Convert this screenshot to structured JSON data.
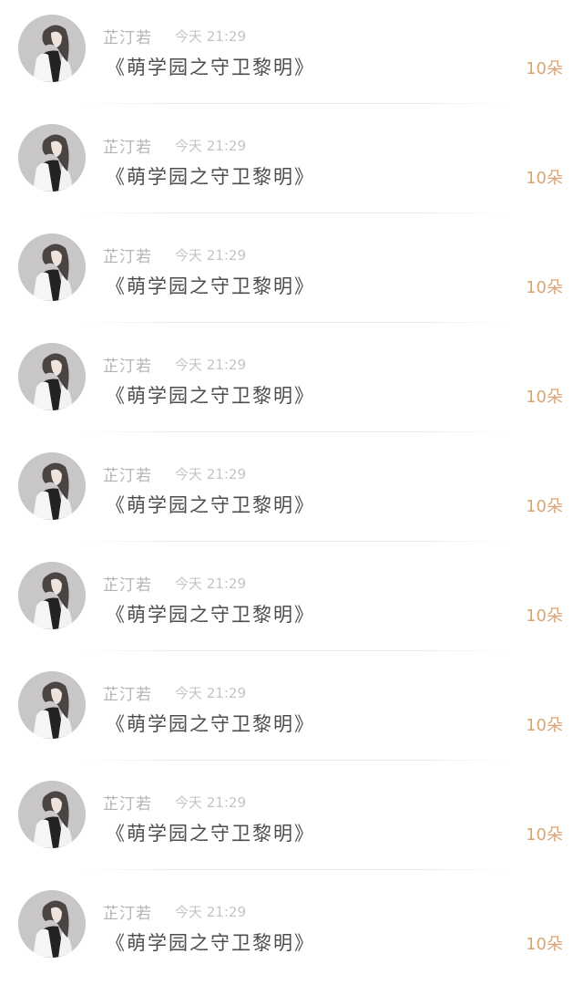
{
  "colors": {
    "count_accent": "#d9a475",
    "name_gray": "#b3b3b3",
    "title_dark": "#4d4d4d"
  },
  "items": [
    {
      "name": "芷汀若",
      "time": "今天 21:29",
      "title": "《萌学园之守卫黎明》",
      "count": "10朵",
      "avatar_icon": "girl-avatar-icon"
    },
    {
      "name": "芷汀若",
      "time": "今天 21:29",
      "title": "《萌学园之守卫黎明》",
      "count": "10朵",
      "avatar_icon": "girl-avatar-icon"
    },
    {
      "name": "芷汀若",
      "time": "今天 21:29",
      "title": "《萌学园之守卫黎明》",
      "count": "10朵",
      "avatar_icon": "girl-avatar-icon"
    },
    {
      "name": "芷汀若",
      "time": "今天 21:29",
      "title": "《萌学园之守卫黎明》",
      "count": "10朵",
      "avatar_icon": "girl-avatar-icon"
    },
    {
      "name": "芷汀若",
      "time": "今天 21:29",
      "title": "《萌学园之守卫黎明》",
      "count": "10朵",
      "avatar_icon": "girl-avatar-icon"
    },
    {
      "name": "芷汀若",
      "time": "今天 21:29",
      "title": "《萌学园之守卫黎明》",
      "count": "10朵",
      "avatar_icon": "girl-avatar-icon"
    },
    {
      "name": "芷汀若",
      "time": "今天 21:29",
      "title": "《萌学园之守卫黎明》",
      "count": "10朵",
      "avatar_icon": "girl-avatar-icon"
    },
    {
      "name": "芷汀若",
      "time": "今天 21:29",
      "title": "《萌学园之守卫黎明》",
      "count": "10朵",
      "avatar_icon": "girl-avatar-icon"
    },
    {
      "name": "芷汀若",
      "time": "今天 21:29",
      "title": "《萌学园之守卫黎明》",
      "count": "10朵",
      "avatar_icon": "girl-avatar-icon"
    }
  ]
}
